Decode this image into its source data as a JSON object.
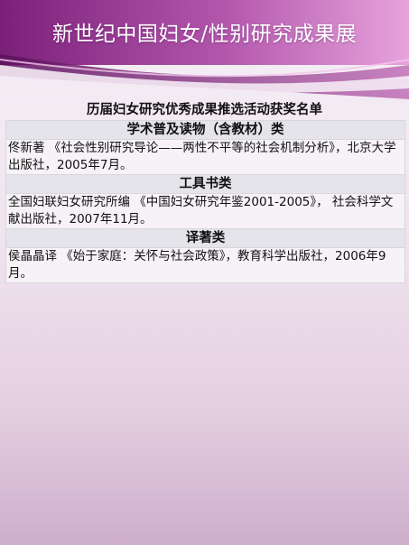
{
  "header": {
    "title": "新世纪中国妇女/性别研究成果展"
  },
  "subtitle": "历届妇女研究优秀成果推选活动获奖名单",
  "sections": [
    {
      "heading": "学术普及读物（含教材）类",
      "body": "佟新著 《社会性别研究导论——两性不平等的社会机制分析》，北京大学出版社，2005年7月。"
    },
    {
      "heading": "工具书类",
      "body": "全国妇联妇女研究所编 《中国妇女研究年鉴2001-2005》， 社会科学文献出版社，2007年11月。"
    },
    {
      "heading": "译著类",
      "body": "侯晶晶译 《始于家庭：关怀与社会政策》，教育科学出版社，2006年9月。"
    }
  ],
  "colors": {
    "banner_dark": "#8a2a8a",
    "banner_light": "#d98bd0",
    "header_row": "#e4e4ea"
  }
}
